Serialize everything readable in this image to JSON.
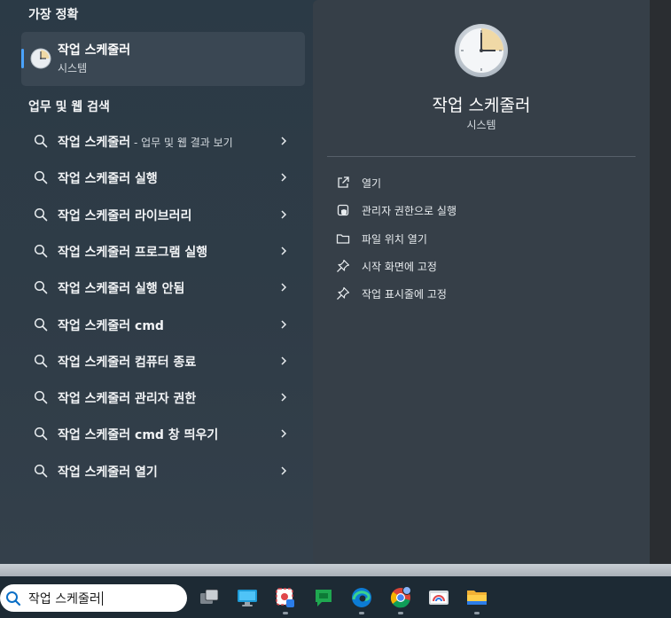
{
  "left": {
    "best_match_heading": "가장 정확",
    "best_match": {
      "title": "작업 스케줄러",
      "subtitle": "시스템"
    },
    "web_heading": "업무 및 웹 검색",
    "results": [
      {
        "label": "작업 스케줄러",
        "suffix": " - 업무 및 웹 결과 보기"
      },
      {
        "label": "작업 스케줄러 실행",
        "suffix": ""
      },
      {
        "label": "작업 스케줄러 라이브러리",
        "suffix": ""
      },
      {
        "label": "작업 스케줄러 프로그램 실행",
        "suffix": ""
      },
      {
        "label": "작업 스케줄러 실행 안됨",
        "suffix": ""
      },
      {
        "label": "작업 스케줄러 cmd",
        "suffix": ""
      },
      {
        "label": "작업 스케줄러 컴퓨터 종료",
        "suffix": ""
      },
      {
        "label": "작업 스케줄러 관리자 권한",
        "suffix": ""
      },
      {
        "label": "작업 스케줄러 cmd 창 띄우기",
        "suffix": ""
      },
      {
        "label": "작업 스케줄러 열기",
        "suffix": ""
      }
    ]
  },
  "detail": {
    "app_name": "작업 스케줄러",
    "app_type": "시스템",
    "actions": [
      {
        "label": "열기",
        "icon": "open-external-icon"
      },
      {
        "label": "관리자 권한으로 실행",
        "icon": "shield-admin-icon"
      },
      {
        "label": "파일 위치 열기",
        "icon": "folder-icon"
      },
      {
        "label": "시작 화면에 고정",
        "icon": "pin-icon"
      },
      {
        "label": "작업 표시줄에 고정",
        "icon": "pin-icon"
      }
    ]
  },
  "taskbar": {
    "search_text": "작업 스케줄러",
    "apps": [
      "task-view-icon",
      "desktop-icon",
      "snipping-tool-icon",
      "chat-icon",
      "edge-icon",
      "chrome-icon",
      "remote-desktop-icon",
      "file-explorer-icon"
    ]
  },
  "colors": {
    "accent": "#4aa3ff",
    "panel": "#2f3c47",
    "detail_panel": "#363f48",
    "taskbar": "#1d2a34"
  }
}
